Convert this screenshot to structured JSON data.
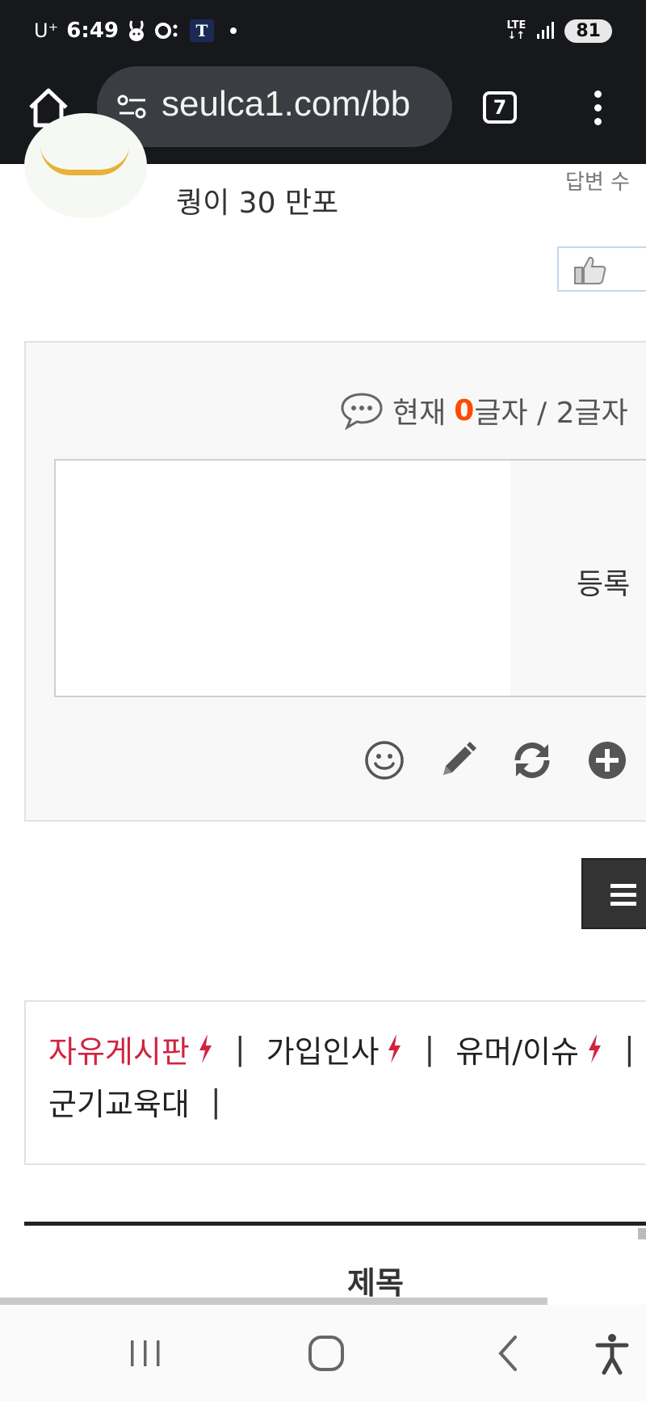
{
  "status_bar": {
    "carrier": "U⁺",
    "time": "6:49",
    "network_top": "LTE",
    "network_bottom": "↓↑",
    "battery": "81",
    "t_badge": "T"
  },
  "browser": {
    "url": "seulca1.com/bb",
    "tab_count": "7"
  },
  "post": {
    "subtitle": "퀑이 30 만포",
    "reply_label": "답변 수"
  },
  "comment": {
    "counter_prefix": "현재",
    "counter_current": "0",
    "counter_suffix": "글자 / 2글자",
    "submit_label": "등록"
  },
  "categories": {
    "row1": [
      {
        "label": "자유게시판",
        "hot": true,
        "flash": true
      },
      {
        "label": "가입인사",
        "hot": false,
        "flash": true
      },
      {
        "label": "유머/이슈",
        "hot": false,
        "flash": true
      }
    ],
    "row2": [
      {
        "label": "군기교육대",
        "hot": false,
        "flash": false
      }
    ],
    "separator": "|"
  },
  "table": {
    "title_header": "제목"
  },
  "colors": {
    "counter_accent": "#ff4a00",
    "hot_category": "#d12340",
    "chrome_bg": "#16181c"
  }
}
